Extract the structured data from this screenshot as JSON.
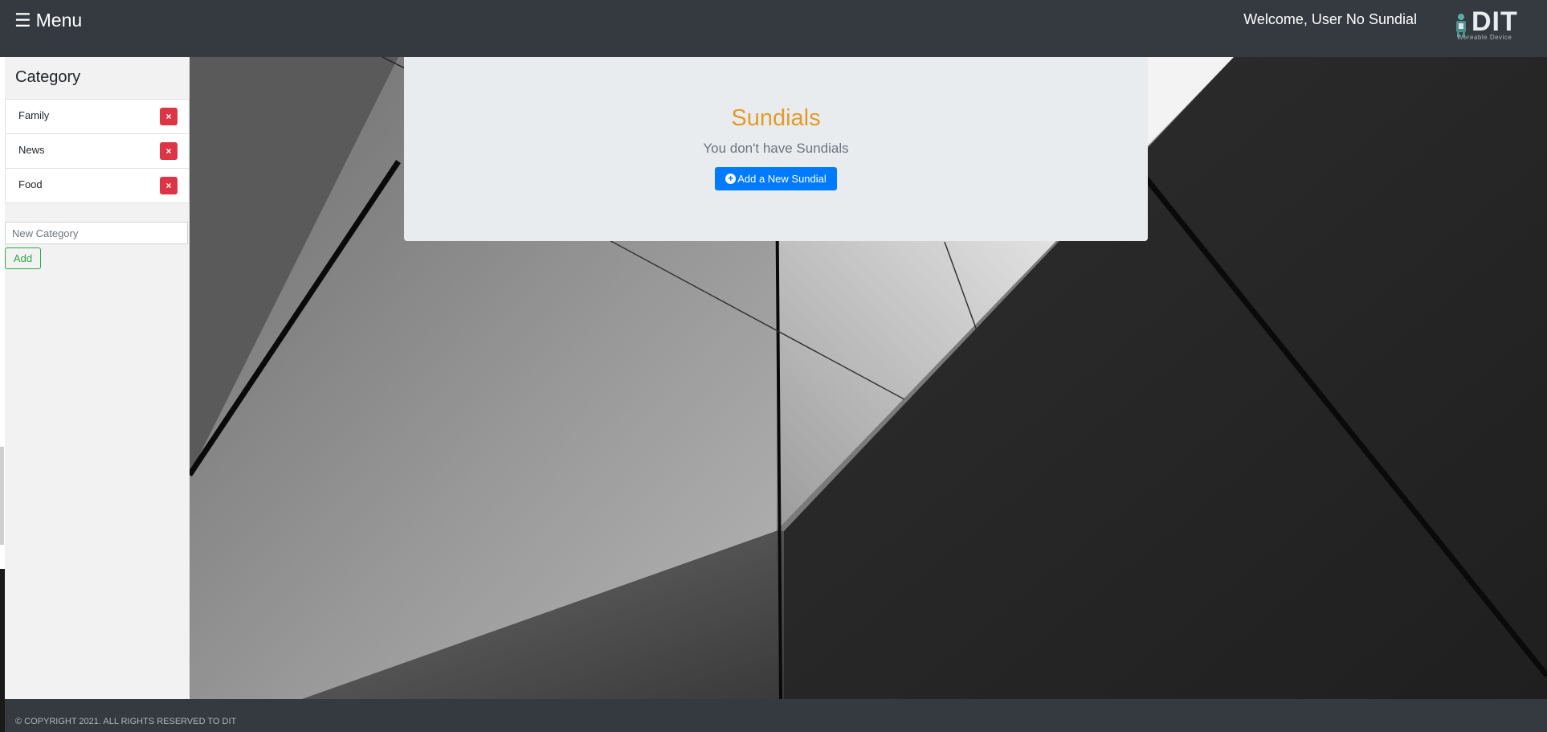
{
  "navbar": {
    "menu_label": "Menu",
    "menu_icon": "hamburger-icon",
    "welcome": "Welcome, User No Sundial",
    "logo_word": "DIT",
    "logo_sub": "Wereable Device"
  },
  "sidebar": {
    "title": "Category",
    "categories": [
      {
        "label": "Family"
      },
      {
        "label": "News"
      },
      {
        "label": "Food"
      }
    ],
    "delete_icon": "×",
    "new_category_placeholder": "New Category",
    "add_label": "Add"
  },
  "card": {
    "title": "Sundials",
    "subtitle": "You don't have Sundials",
    "button_label": "Add a New Sundial",
    "button_icon": "+"
  },
  "footer": {
    "text": "© COPYRIGHT 2021. ALL RIGHTS RESERVED TO DIT"
  },
  "colors": {
    "navbar": "#343a40",
    "accent_title": "#e39b2a",
    "primary": "#007bff",
    "danger": "#dc3545",
    "success": "#28a745"
  }
}
